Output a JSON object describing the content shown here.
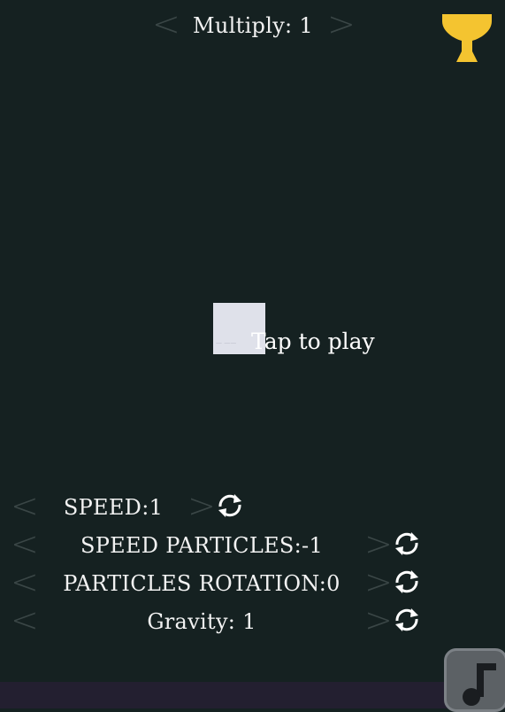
{
  "header": {
    "multiply_label": "Multiply: 1",
    "prev_glyph": "<",
    "next_glyph": ">"
  },
  "trophy": {
    "icon": "trophy-icon",
    "color": "#f4c430"
  },
  "play": {
    "prompt": "Tap to play",
    "square_text": "— ——",
    "square_color": "#dfe1ea"
  },
  "settings": {
    "speed": {
      "label": "SPEED:1",
      "prev": "<",
      "next": ">"
    },
    "speed_particles": {
      "label": "SPEED PARTICLES:-1",
      "prev": "<",
      "next": ">"
    },
    "particles_rotation": {
      "label": "PARTICLES ROTATION:0",
      "prev": "<",
      "next": ">"
    },
    "gravity": {
      "label": "Gravity: 1",
      "prev": "<",
      "next": ">"
    },
    "reset_icon": "refresh-icon"
  },
  "music_button": {
    "icon": "music-note-icon"
  },
  "colors": {
    "background": "#152121",
    "arrow": "#3a4646",
    "bottom_bar": "#231f30"
  }
}
